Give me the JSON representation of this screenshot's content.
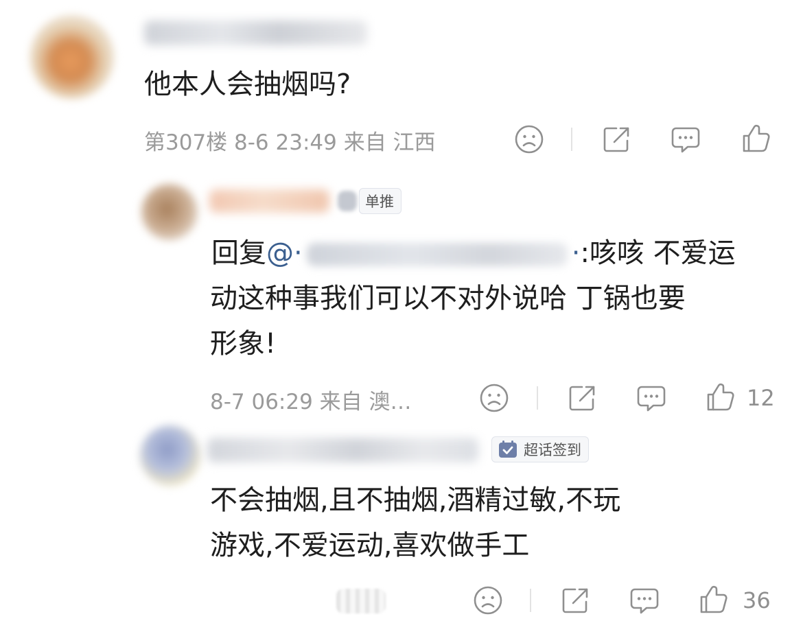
{
  "comment": {
    "text": "他本人会抽烟吗?",
    "meta": "第307楼 8-6 23:49 来自 江西"
  },
  "reply1": {
    "badge": "单推",
    "reply_prefix": "回复",
    "reply_mention_start": "@·",
    "reply_mention_end": "·",
    "reply_line1_rest": ":咳咳 不爱运",
    "line2": "动这种事我们可以不对外说哈 丁锅也要",
    "line3": "形象!",
    "meta": "8-7 06:29 来自 澳…",
    "likes": "12"
  },
  "reply2": {
    "badge": "超话签到",
    "line1": "不会抽烟,且不抽烟,酒精过敏,不玩",
    "line2": "游戏,不爱运动,喜欢做手工",
    "likes": "36"
  },
  "icons": {
    "dislike": "sad-face-icon",
    "share": "share-icon",
    "comment": "comment-icon",
    "like": "thumbs-up-icon"
  },
  "colors": {
    "mention": "#3b5f8f",
    "meta": "#9a9a9a",
    "icon": "#8f8f8f"
  }
}
